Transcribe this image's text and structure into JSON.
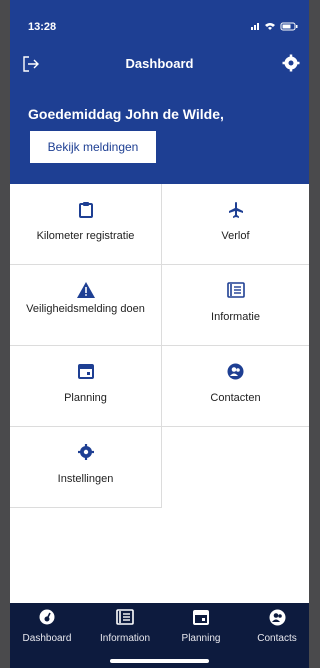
{
  "statusbar": {
    "time": "13:28"
  },
  "navbar": {
    "title": "Dashboard",
    "logout_icon": "logout-icon",
    "settings_icon": "gear-icon"
  },
  "header": {
    "greeting": "Goedemiddag John de Wilde,",
    "button_label": "Bekijk meldingen"
  },
  "tiles": [
    {
      "label": "Kilometer registratie",
      "icon": "clipboard-icon"
    },
    {
      "label": "Verlof",
      "icon": "airplane-icon"
    },
    {
      "label": "Veiligheidsmelding doen",
      "icon": "warning-icon"
    },
    {
      "label": "Informatie",
      "icon": "document-icon"
    },
    {
      "label": "Planning",
      "icon": "calendar-icon"
    },
    {
      "label": "Contacten",
      "icon": "contacts-icon"
    },
    {
      "label": "Instellingen",
      "icon": "gear-icon"
    }
  ],
  "tabbar": [
    {
      "label": "Dashboard",
      "icon": "dashboard-icon"
    },
    {
      "label": "Information",
      "icon": "document-icon"
    },
    {
      "label": "Planning",
      "icon": "calendar-icon"
    },
    {
      "label": "Contacts",
      "icon": "contacts-icon"
    }
  ],
  "colors": {
    "primary": "#1e3f93",
    "tabbar": "#0d1b3e"
  }
}
